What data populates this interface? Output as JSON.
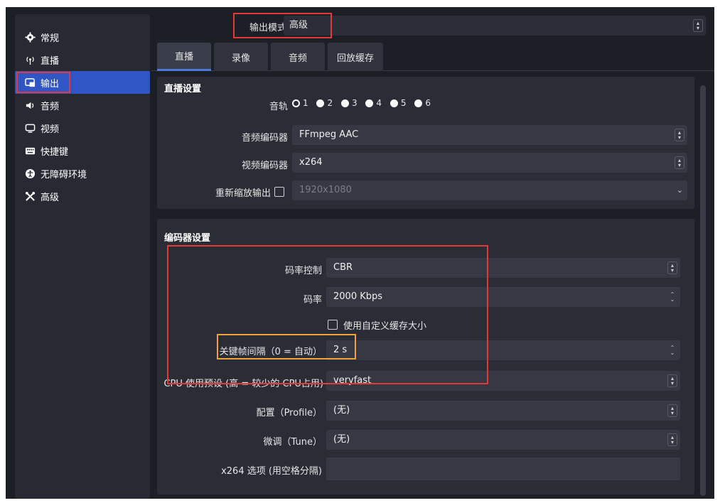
{
  "sidebar": {
    "items": [
      {
        "label": "常规",
        "icon": "gear-icon"
      },
      {
        "label": "直播",
        "icon": "antenna-icon"
      },
      {
        "label": "输出",
        "icon": "output-icon"
      },
      {
        "label": "音频",
        "icon": "speaker-icon"
      },
      {
        "label": "视频",
        "icon": "monitor-icon"
      },
      {
        "label": "快捷键",
        "icon": "keyboard-icon"
      },
      {
        "label": "无障碍环境",
        "icon": "accessibility-icon"
      },
      {
        "label": "高级",
        "icon": "tools-icon"
      }
    ]
  },
  "output_mode": {
    "label": "输出模式",
    "value": "高级"
  },
  "tabs": [
    "直播",
    "录像",
    "音频",
    "回放缓存"
  ],
  "stream_settings": {
    "title": "直播设置",
    "audio_track_label": "音轨",
    "tracks": [
      "1",
      "2",
      "3",
      "4",
      "5",
      "6"
    ],
    "audio_encoder_label": "音频编码器",
    "audio_encoder_value": "FFmpeg AAC",
    "video_encoder_label": "视频编码器",
    "video_encoder_value": "x264",
    "rescale_label": "重新缩放输出",
    "rescale_value": "1920x1080"
  },
  "encoder_settings": {
    "title": "编码器设置",
    "rate_control_label": "码率控制",
    "rate_control_value": "CBR",
    "bitrate_label": "码率",
    "bitrate_value": "2000 Kbps",
    "custom_buffer_label": "使用自定义缓存大小",
    "keyframe_label": "关键帧间隔（0 = 自动）",
    "keyframe_value": "2 s",
    "cpu_preset_label": "CPU 使用预设 (高 = 较少的 CPU占用)",
    "cpu_preset_value": "veryfast",
    "profile_label": "配置（Profile）",
    "profile_value": "(无)",
    "tune_label": "微调（Tune）",
    "tune_value": "(无)",
    "x264_options_label": "x264 选项 (用空格分隔)",
    "x264_options_value": ""
  },
  "colors": {
    "accent": "#2f56c4",
    "highlight_red": "#e53935",
    "highlight_orange": "#f5a23d"
  }
}
